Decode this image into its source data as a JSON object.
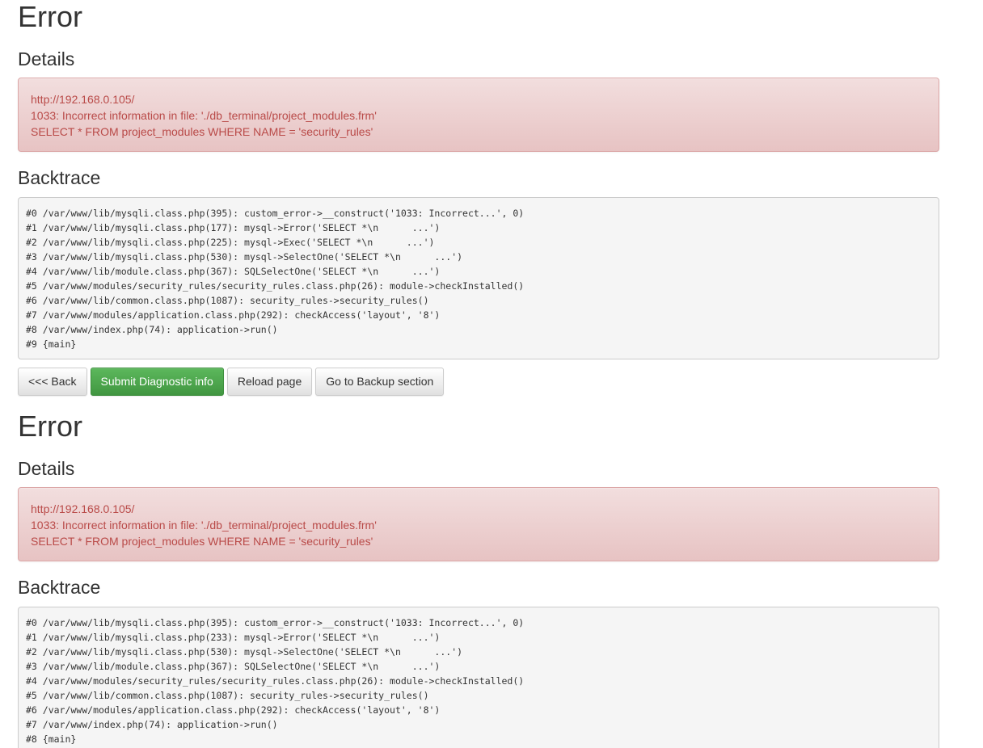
{
  "error1": {
    "title": "Error",
    "details_heading": "Details",
    "details": [
      "http://192.168.0.105/",
      "1033: Incorrect information in file: './db_terminal/project_modules.frm'",
      "SELECT * FROM project_modules WHERE NAME = 'security_rules'"
    ],
    "backtrace_heading": "Backtrace",
    "backtrace": [
      "#0 /var/www/lib/mysqli.class.php(395): custom_error->__construct('1033: Incorrect...', 0)",
      "#1 /var/www/lib/mysqli.class.php(177): mysql->Error('SELECT *\\n      ...')",
      "#2 /var/www/lib/mysqli.class.php(225): mysql->Exec('SELECT *\\n      ...')",
      "#3 /var/www/lib/mysqli.class.php(530): mysql->SelectOne('SELECT *\\n      ...')",
      "#4 /var/www/lib/module.class.php(367): SQLSelectOne('SELECT *\\n      ...')",
      "#5 /var/www/modules/security_rules/security_rules.class.php(26): module->checkInstalled()",
      "#6 /var/www/lib/common.class.php(1087): security_rules->security_rules()",
      "#7 /var/www/modules/application.class.php(292): checkAccess('layout', '8')",
      "#8 /var/www/index.php(74): application->run()",
      "#9 {main}"
    ],
    "buttons": {
      "back": "<<< Back",
      "submit": "Submit Diagnostic info",
      "reload": "Reload page",
      "backup": "Go to Backup section"
    }
  },
  "error2": {
    "title": "Error",
    "details_heading": "Details",
    "details": [
      "http://192.168.0.105/",
      "1033: Incorrect information in file: './db_terminal/project_modules.frm'",
      "SELECT * FROM project_modules WHERE NAME = 'security_rules'"
    ],
    "backtrace_heading": "Backtrace",
    "backtrace": [
      "#0 /var/www/lib/mysqli.class.php(395): custom_error->__construct('1033: Incorrect...', 0)",
      "#1 /var/www/lib/mysqli.class.php(233): mysql->Error('SELECT *\\n      ...')",
      "#2 /var/www/lib/mysqli.class.php(530): mysql->SelectOne('SELECT *\\n      ...')",
      "#3 /var/www/lib/module.class.php(367): SQLSelectOne('SELECT *\\n      ...')",
      "#4 /var/www/modules/security_rules/security_rules.class.php(26): module->checkInstalled()",
      "#5 /var/www/lib/common.class.php(1087): security_rules->security_rules()",
      "#6 /var/www/modules/application.class.php(292): checkAccess('layout', '8')",
      "#7 /var/www/index.php(74): application->run()",
      "#8 {main}"
    ]
  },
  "colors": {
    "alert_text": "#b94a48",
    "alert_bg": "#f2dede",
    "success": "#5cb85c"
  }
}
